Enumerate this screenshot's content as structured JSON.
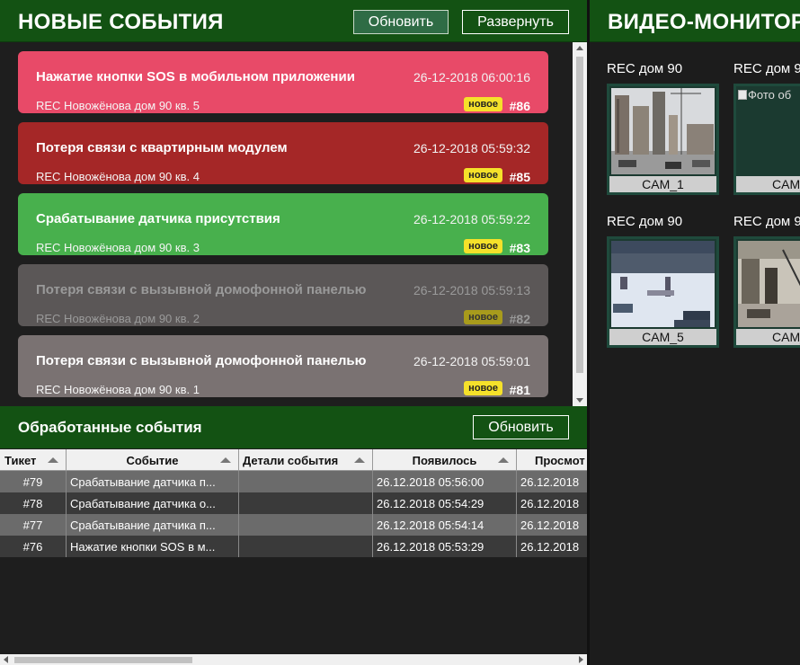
{
  "new_events": {
    "title": "НОВЫЕ СОБЫТИЯ",
    "refresh_label": "Обновить",
    "expand_label": "Развернуть",
    "items": [
      {
        "title": "Нажатие кнопки SOS в мобильном приложении",
        "time": "26-12-2018 06:00:16",
        "address": "REC Новожёнова дом 90 кв. 5",
        "badge": "новое",
        "number": "#86",
        "color": "#e84a68"
      },
      {
        "title": "Потеря связи с квартирным модулем",
        "time": "26-12-2018 05:59:32",
        "address": "REC Новожёнова дом 90 кв. 4",
        "badge": "новое",
        "number": "#85",
        "color": "#a52727"
      },
      {
        "title": "Срабатывание датчика присутствия",
        "time": "26-12-2018 05:59:22",
        "address": "REC Новожёнова дом 90 кв. 3",
        "badge": "новое",
        "number": "#83",
        "color": "#48b04d"
      },
      {
        "title": "Потеря связи с вызывной домофонной панелью",
        "time": "26-12-2018 05:59:13",
        "address": "REC Новожёнова дом 90 кв. 2",
        "badge": "новое",
        "number": "#82",
        "color": "#5b5757"
      },
      {
        "title": "Потеря связи с вызывной домофонной панелью",
        "time": "26-12-2018 05:59:01",
        "address": "REC Новожёнова дом 90 кв. 1",
        "badge": "новое",
        "number": "#81",
        "color": "#7a7272"
      }
    ]
  },
  "processed": {
    "title": "Обработанные события",
    "refresh_label": "Обновить",
    "columns": [
      "Тикет",
      "Событие",
      "Детали события",
      "Появилось",
      "Просмот"
    ],
    "rows": [
      {
        "ticket": "#79",
        "event": "Срабатывание датчика п...",
        "details": "",
        "appeared": "26.12.2018 05:56:00",
        "viewed": "26.12.2018"
      },
      {
        "ticket": "#78",
        "event": "Срабатывание датчика о...",
        "details": "",
        "appeared": "26.12.2018 05:54:29",
        "viewed": "26.12.2018"
      },
      {
        "ticket": "#77",
        "event": "Срабатывание датчика п...",
        "details": "",
        "appeared": "26.12.2018 05:54:14",
        "viewed": "26.12.2018"
      },
      {
        "ticket": "#76",
        "event": "Нажатие кнопки SOS в м...",
        "details": "",
        "appeared": "26.12.2018 05:53:29",
        "viewed": "26.12.2018"
      }
    ]
  },
  "video": {
    "title": "ВИДЕО-МОНИТОР",
    "cameras": [
      {
        "label": "REC дом 90",
        "name": "CAM_1",
        "broken": false
      },
      {
        "label": "REC дом 9",
        "name": "CAM_",
        "broken": true,
        "alt": "Фото об"
      },
      {
        "label": "REC дом 90",
        "name": "CAM_5",
        "broken": false
      },
      {
        "label": "REC дом 9",
        "name": "CAM_",
        "broken": false
      }
    ]
  },
  "colors": {
    "header_green": "#135213",
    "badge_yellow": "#f5e12a"
  }
}
